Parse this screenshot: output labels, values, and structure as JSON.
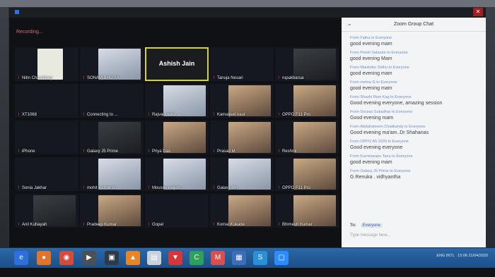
{
  "meeting": {
    "recording_label": "Recording..."
  },
  "participants": [
    {
      "name": "Nitin Chaudhary",
      "video": "logo"
    },
    {
      "name": "SONAM BHUTIA",
      "video": "light"
    },
    {
      "name": "Ashish Jain",
      "video": "none",
      "active": true
    },
    {
      "name": "Tanuja Nesari",
      "video": "none"
    },
    {
      "name": "rupakbarua",
      "video": "dark"
    },
    {
      "name": "XT1068",
      "video": "none"
    },
    {
      "name": "Connecting to ...",
      "video": "none"
    },
    {
      "name": "Rajvant kaur",
      "video": "light"
    },
    {
      "name": "Kamaljeet kaur",
      "video": "warm"
    },
    {
      "name": "OPPO F11 Pro",
      "video": "warm"
    },
    {
      "name": "iPhone",
      "video": "none"
    },
    {
      "name": "Galaxy J5 Prime",
      "video": "dark"
    },
    {
      "name": "Priya Das",
      "video": "warm"
    },
    {
      "name": "Prasad M",
      "video": "warm"
    },
    {
      "name": "Reshmi",
      "video": "warm"
    },
    {
      "name": "Sonia Jakhar",
      "video": "none"
    },
    {
      "name": "mohit Kumar 8...",
      "video": "light"
    },
    {
      "name": "Mousmi majum...",
      "video": "light"
    },
    {
      "name": "Galaxy J4+",
      "video": "light"
    },
    {
      "name": "OPPO F11 Pro",
      "video": "warm"
    },
    {
      "name": "Anil Kuhayah",
      "video": "dark"
    },
    {
      "name": "Pradeep Kumar",
      "video": "warm"
    },
    {
      "name": "Gopal",
      "video": "none"
    },
    {
      "name": "Komal Kukade",
      "video": "warm"
    },
    {
      "name": "Bhimesh Kumar",
      "video": "warm"
    }
  ],
  "chat": {
    "title": "Zoom Group Chat",
    "messages": [
      {
        "from": "From Fatha to Everyone",
        "text": "good evening mam"
      },
      {
        "from": "From Preeti Sahoute to Everyone",
        "text": "good evening Mam"
      },
      {
        "from": "From Maninder Sidhu to Everyone",
        "text": "good evening mam"
      },
      {
        "from": "From reetna G to Everyone",
        "text": "good evening mam"
      },
      {
        "from": "From Shashi Ram Kag to Everyone",
        "text": "Good evening everyone, amazing session"
      },
      {
        "from": "From Gourav Sukadhar to Everyone",
        "text": "Good evening mam"
      },
      {
        "from": "From Abdulraheem Chalikandy to Everyone",
        "text": "Good evening ma'am..Dr Shahanas"
      },
      {
        "from": "From OPPO A5 2020 to Everyone",
        "text": "Good evening everyone"
      },
      {
        "from": "From Kummarapu Tanu to Everyone",
        "text": "good evening mam"
      },
      {
        "from": "From Galaxy J5 Prime to Everyone",
        "text": "G.Renuka . vidhyantha"
      }
    ],
    "to_label": "To:",
    "to_value": "Everyone",
    "placeholder": "Type message here..."
  },
  "taskbar": {
    "tray_lang": "ENG",
    "tray_region": "INTL",
    "time": "15:06",
    "date": "21/04/2020"
  }
}
